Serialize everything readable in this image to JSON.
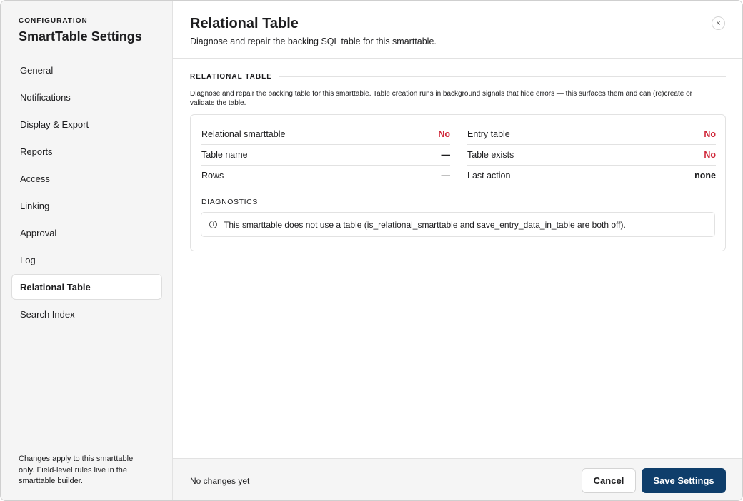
{
  "sidebar": {
    "eyebrow": "CONFIGURATION",
    "title": "SmartTable Settings",
    "items": [
      {
        "label": "General"
      },
      {
        "label": "Notifications"
      },
      {
        "label": "Display & Export"
      },
      {
        "label": "Reports"
      },
      {
        "label": "Access"
      },
      {
        "label": "Linking"
      },
      {
        "label": "Approval"
      },
      {
        "label": "Log"
      },
      {
        "label": "Relational Table",
        "active": true
      },
      {
        "label": "Search Index"
      }
    ],
    "footnote": "Changes apply to this smarttable only. Field-level rules live in the smarttable builder."
  },
  "header": {
    "title": "Relational Table",
    "subtitle": "Diagnose and repair the backing SQL table for this smarttable.",
    "close_icon": "×"
  },
  "section": {
    "label": "RELATIONAL TABLE",
    "description": "Diagnose and repair the backing table for this smarttable. Table creation runs in background signals that hide errors — this surfaces them and can (re)create or validate the table."
  },
  "status_left": [
    {
      "key": "Relational smarttable",
      "value": "No"
    },
    {
      "key": "Table name",
      "value": "—"
    },
    {
      "key": "Rows",
      "value": "—"
    }
  ],
  "status_right": [
    {
      "key": "Entry table",
      "value": "No"
    },
    {
      "key": "Table exists",
      "value": "No"
    },
    {
      "key": "Last action",
      "value": "none"
    }
  ],
  "diagnostics": {
    "label": "DIAGNOSTICS",
    "icon": "info-icon",
    "message": "This smarttable does not use a table (is_relational_smarttable and save_entry_data_in_table are both off)."
  },
  "footer": {
    "status": "No changes yet",
    "cancel_label": "Cancel",
    "save_label": "Save Settings"
  },
  "colors": {
    "accent": "#0f3e6b",
    "negative": "#d0293b",
    "sidebar_bg": "#f5f5f5"
  }
}
